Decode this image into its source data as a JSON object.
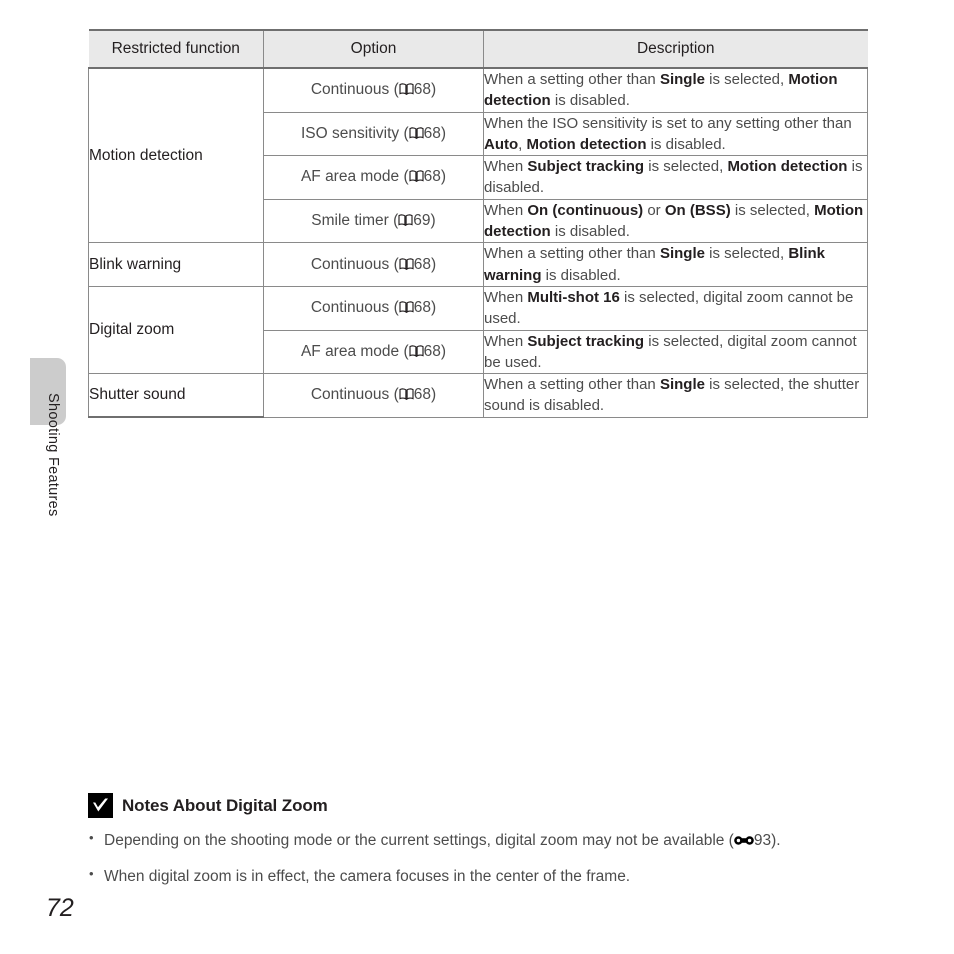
{
  "page": {
    "number": "72",
    "chapter_label": "Shooting Features"
  },
  "table": {
    "headers": {
      "function": "Restricted function",
      "option": "Option",
      "description": "Description"
    },
    "groups": [
      {
        "function": "Motion detection",
        "rows": [
          {
            "option_text": "Continuous (",
            "option_ref_icon": "book-icon",
            "option_ref_page": "68)",
            "description_parts": [
              {
                "t": "When a setting other than ",
                "b": false
              },
              {
                "t": "Single",
                "b": true
              },
              {
                "t": " is selected, ",
                "b": false
              },
              {
                "t": "Motion detection",
                "b": true
              },
              {
                "t": " is disabled.",
                "b": false
              }
            ]
          },
          {
            "option_text": "ISO sensitivity (",
            "option_ref_icon": "book-icon",
            "option_ref_page": "68)",
            "description_parts": [
              {
                "t": "When the ISO sensitivity is set to any setting other than ",
                "b": false
              },
              {
                "t": "Auto",
                "b": true
              },
              {
                "t": ", ",
                "b": false
              },
              {
                "t": "Motion detection",
                "b": true
              },
              {
                "t": " is disabled.",
                "b": false
              }
            ]
          },
          {
            "option_text": "AF area mode (",
            "option_ref_icon": "book-icon",
            "option_ref_page": "68)",
            "description_parts": [
              {
                "t": "When ",
                "b": false
              },
              {
                "t": "Subject tracking",
                "b": true
              },
              {
                "t": " is selected, ",
                "b": false
              },
              {
                "t": "Motion detection",
                "b": true
              },
              {
                "t": " is disabled.",
                "b": false
              }
            ]
          },
          {
            "option_text": "Smile timer (",
            "option_ref_icon": "book-icon",
            "option_ref_page": "69)",
            "description_parts": [
              {
                "t": "When ",
                "b": false
              },
              {
                "t": "On (continuous)",
                "b": true
              },
              {
                "t": " or ",
                "b": false
              },
              {
                "t": "On (BSS)",
                "b": true
              },
              {
                "t": " is selected, ",
                "b": false
              },
              {
                "t": "Motion detection",
                "b": true
              },
              {
                "t": " is disabled.",
                "b": false
              }
            ]
          }
        ]
      },
      {
        "function": "Blink warning",
        "rows": [
          {
            "option_text": "Continuous (",
            "option_ref_icon": "book-icon",
            "option_ref_page": "68)",
            "description_parts": [
              {
                "t": "When a setting other than ",
                "b": false
              },
              {
                "t": "Single",
                "b": true
              },
              {
                "t": " is selected, ",
                "b": false
              },
              {
                "t": "Blink warning",
                "b": true
              },
              {
                "t": " is disabled.",
                "b": false
              }
            ]
          }
        ]
      },
      {
        "function": "Digital zoom",
        "rows": [
          {
            "option_text": "Continuous (",
            "option_ref_icon": "book-icon",
            "option_ref_page": "68)",
            "description_parts": [
              {
                "t": "When ",
                "b": false
              },
              {
                "t": "Multi-shot 16",
                "b": true
              },
              {
                "t": " is selected, digital zoom cannot be used.",
                "b": false
              }
            ]
          },
          {
            "option_text": "AF area mode (",
            "option_ref_icon": "book-icon",
            "option_ref_page": "68)",
            "description_parts": [
              {
                "t": "When ",
                "b": false
              },
              {
                "t": "Subject tracking",
                "b": true
              },
              {
                "t": " is selected, digital zoom cannot be used.",
                "b": false
              }
            ]
          }
        ]
      },
      {
        "function": "Shutter sound",
        "rows": [
          {
            "option_text": "Continuous (",
            "option_ref_icon": "book-icon",
            "option_ref_page": "68)",
            "description_parts": [
              {
                "t": "When a setting other than ",
                "b": false
              },
              {
                "t": "Single",
                "b": true
              },
              {
                "t": " is selected, the shutter sound is disabled.",
                "b": false
              }
            ]
          }
        ]
      }
    ]
  },
  "notes": {
    "icon": "caution-check-icon",
    "title": "Notes About Digital Zoom",
    "items": [
      {
        "prefix": "Depending on the shooting mode or the current settings, digital zoom may not be available (",
        "ref_icon": "advanced-section-icon",
        "ref_page": "93).",
        "suffix": ""
      },
      {
        "prefix": "When digital zoom is in effect, the camera focuses in the center of the frame.",
        "ref_icon": null,
        "ref_page": "",
        "suffix": ""
      }
    ]
  },
  "colors": {
    "header_bg": "#e9e9e9",
    "border": "#8a8a8a",
    "heavy_border": "#6f6f6f",
    "body_text": "#4c4c4c",
    "strong_text": "#231f20",
    "tab_gray": "#cccccc"
  }
}
